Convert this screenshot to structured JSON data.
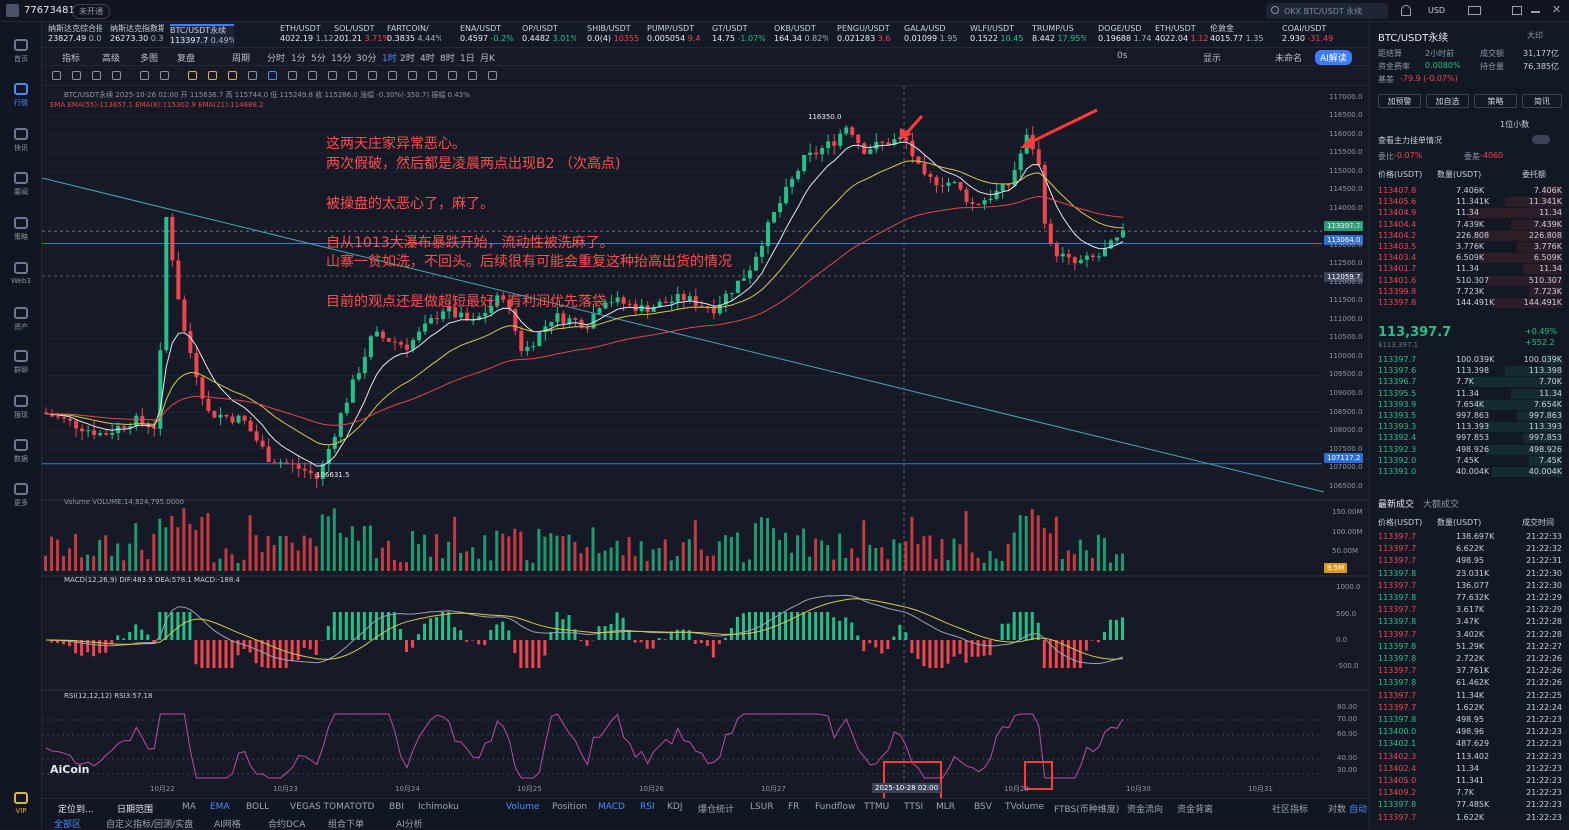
{
  "topbar": {
    "account": "77673481",
    "badge": "未开通",
    "search_placeholder": "OKX BTC/USDT 永续",
    "currency": "USD"
  },
  "leftnav": [
    {
      "label": "首页"
    },
    {
      "label": "行情"
    },
    {
      "label": "快讯"
    },
    {
      "label": "要闻"
    },
    {
      "label": "策略"
    },
    {
      "label": "Web3"
    },
    {
      "label": "资产"
    },
    {
      "label": "群聊"
    },
    {
      "label": "搜现"
    },
    {
      "label": "数据"
    },
    {
      "label": "更多"
    },
    {
      "label": "VIP"
    }
  ],
  "tickers": [
    {
      "name": "纳斯达克综合指",
      "price": "23827.49",
      "chg": "0.00%",
      "dir": "flat"
    },
    {
      "name": "纳斯达克指数期",
      "price": "26273.30",
      "chg": "0.33%",
      "dir": "flat"
    },
    {
      "name": "BTC/USDT永续",
      "price": "113397.7",
      "chg": "0.49%",
      "dir": "active"
    },
    {
      "name": "ETH/USDT",
      "price": "4022.19",
      "chg": "1.12",
      "dir": "flat"
    },
    {
      "name": "SOL/USDT",
      "price": "201.21",
      "chg": "3.71%",
      "dir": "dn"
    },
    {
      "name": "FARTCOIN/",
      "price": "0.3835",
      "chg": "4.44%",
      "dir": "flat"
    },
    {
      "name": "ENA/USDT",
      "price": "0.4597",
      "chg": "-0.2%",
      "dir": "up"
    },
    {
      "name": "OP/USDT",
      "price": "0.4482",
      "chg": "3.01%",
      "dir": "up"
    },
    {
      "name": "SHIB/USDT",
      "price": "0.0(4)",
      "chg": "10355",
      "dir": "dn"
    },
    {
      "name": "PUMP/USDT",
      "price": "0.005054",
      "chg": "9.4",
      "dir": "dn"
    },
    {
      "name": "GT/USDT",
      "price": "14.75",
      "chg": "-1.07%",
      "dir": "up"
    },
    {
      "name": "OKB/USDT",
      "price": "164.34",
      "chg": "0.82%",
      "dir": "flat"
    },
    {
      "name": "PENGU/USDT",
      "price": "0.021283",
      "chg": "3.6",
      "dir": "dn"
    },
    {
      "name": "GALA/USD",
      "price": "0.01099",
      "chg": "1.95",
      "dir": "flat"
    },
    {
      "name": "WLFI/USDT",
      "price": "0.1522",
      "chg": "10.45",
      "dir": "up"
    },
    {
      "name": "TRUMP/US",
      "price": "8.442",
      "chg": "17.95%",
      "dir": "up"
    },
    {
      "name": "DOGE/USD",
      "price": "0.19688",
      "chg": "1.74",
      "dir": "flat"
    },
    {
      "name": "ETH/USDT",
      "price": "4022.04",
      "chg": "1.12",
      "dir": "dn"
    },
    {
      "name": "伦敦金",
      "price": "4015.77",
      "chg": "1.35%",
      "dir": "flat"
    },
    {
      "name": "COAI/USDT",
      "price": "2.930",
      "chg": "-31.49",
      "dir": "dn"
    }
  ],
  "toolbar1": {
    "indicator": "指标",
    "advanced": "高级",
    "multi": "多图",
    "restore": "复盘",
    "period": "周期",
    "intervals": [
      "分时",
      "1分",
      "5分",
      "15分",
      "30分",
      "1时",
      "2时",
      "4时",
      "8时",
      "1日",
      "月K"
    ],
    "active_interval": "1时",
    "display": "显示",
    "unnamed": "未命名",
    "ai": "AI解读",
    "zero_s": "0s"
  },
  "chart": {
    "info_line": "BTC/USDT永续 2025-10-26 02:00 开 115636.7 高 115744.0 低 115249.8 收 115286.0 涨幅 -0.30%(-350.7) 振幅 0.43%",
    "ema_line": "EMA EMA(55):113657.1 EMA(8):115302.9 EMA(21):114888.2",
    "annotations": [
      "这两天庄家异常恶心。",
      "两次假破，然后都是凌晨两点出现B2 （次高点)",
      "被操盘的太恶心了，麻了。",
      "自从1013大瀑布暴跌开始，流动性被洗麻了。",
      "山寨一贫如洗，不回头。后续很有可能会重复这种抬高出货的情况",
      "目前的观点还是做超短最好，有利润优先落袋"
    ],
    "price_axis": [
      "117000.0",
      "116500.0",
      "116000.0",
      "115500.0",
      "115000.0",
      "114500.0",
      "114000.0",
      "113500.0",
      "113000.0",
      "112500.0",
      "112000.0",
      "111500.0",
      "111000.0",
      "110500.0",
      "110000.0",
      "109500.0",
      "109000.0",
      "108500.0",
      "108000.0",
      "107500.0",
      "107000.0",
      "106500.0"
    ],
    "current_price_tag": "113397.7",
    "line_tag1": "113064.0",
    "crosshair_tag": "112059.7",
    "line_tag2": "107117.2",
    "high_label": "116350.0",
    "low_label": "106631.5",
    "volume_line": "Volume VOLUME:14,824,795.0000",
    "volume_axis": [
      "150.00M",
      "100.00M",
      "50.00M"
    ],
    "volume_tag": "9.5M",
    "macd_line": "MACD(12,26,9) DIF:483.9 DEA:578.1 MACD:-188.4",
    "macd_axis": [
      "1000.0",
      "500.0",
      "0.0",
      "-500.0"
    ],
    "rsi_line": "RSI(12,12,12) RSI3:57.18",
    "rsi_axis": [
      "80.00",
      "70.00",
      "60.00",
      "40.00",
      "30.00"
    ],
    "date_labels": [
      "10月22",
      "10月23",
      "10月24",
      "10月25",
      "10月26",
      "10月27",
      "10月28",
      "10月29",
      "10月30",
      "10月31"
    ],
    "crosshair_date": "2025-10-28 02:00",
    "logo": "AiCoin"
  },
  "chart_data": {
    "type": "line",
    "title": "BTC/USDT永续",
    "ylim": [
      106500,
      117000
    ],
    "x": [
      "10月22",
      "10月23",
      "10月24",
      "10月25",
      "10月26",
      "10月27",
      "10月28",
      "10月29",
      "10月30"
    ],
    "series": [
      {
        "name": "BTC/USDT永续",
        "values": [
          108000,
          106700,
          109800,
          110700,
          111600,
          112800,
          115500,
          115900,
          113400
        ]
      }
    ],
    "high": 116350.0,
    "low": 106631.5,
    "current": 113397.7
  },
  "bottombar": {
    "items": [
      "定位到...",
      "日期范围",
      "MA",
      "EMA",
      "BOLL",
      "VEGAS TOMATO",
      "TD",
      "BBI",
      "Ichimoku",
      "Volume",
      "Position",
      "MACD",
      "RSI",
      "KDJ",
      "爆仓统计",
      "LSUR",
      "FR",
      "Fundflow",
      "TTMU",
      "TTSI",
      "MLR",
      "BSV",
      "TVolume",
      "FTBS(币种维度)",
      "资金流向",
      "资金背离"
    ],
    "right": [
      "社区指标",
      "对数",
      "自动"
    ],
    "row2": [
      "全部区",
      "自定义指标/回测/实盘",
      "AI网格",
      "合约DCA",
      "组合下单",
      "AI分析"
    ]
  },
  "rightpanel": {
    "title": "BTC/USDT永续",
    "size_label": "大印",
    "rows": [
      {
        "l": "距结算",
        "lv": "2小时前",
        "r": "成交额",
        "rv": "31,177亿"
      },
      {
        "l": "资金费率",
        "lv": "0.0080%",
        "r": "持仓量",
        "rv": "76,385亿"
      },
      {
        "l": "基差",
        "lv": "-79.9 (-0.07%)",
        "r": "",
        "rv": ""
      }
    ],
    "buttons": [
      "加预警",
      "加自选",
      "策略",
      "简讯"
    ],
    "depth_label": "1位小数",
    "mainforce": "查看主力挂单情况",
    "ratio_l": "委比",
    "ratio_lv": "-0.07%",
    "diff_l": "委差",
    "diff_v": "-4060",
    "ob_headers": [
      "价格(USDT)",
      "数量(USDT)",
      "委托额"
    ],
    "asks": [
      [
        "113407.8",
        "7.406K",
        "7.406K"
      ],
      [
        "113405.6",
        "11.341K",
        "11.341K"
      ],
      [
        "113404.9",
        "11.34",
        "11.34"
      ],
      [
        "113404.4",
        "7.439K",
        "7.439K"
      ],
      [
        "113404.2",
        "226.808",
        "226.808"
      ],
      [
        "113403.5",
        "3.776K",
        "3.776K"
      ],
      [
        "113403.4",
        "6.509K",
        "6.509K"
      ],
      [
        "113401.7",
        "11.34",
        "11.34"
      ],
      [
        "113401.6",
        "510.307",
        "510.307"
      ],
      [
        "113399.8",
        "7.723K",
        "7.723K"
      ],
      [
        "113397.8",
        "144.491K",
        "144.491K"
      ]
    ],
    "mid_price": "113,397.7",
    "mid_sub": "$113,397.1",
    "mid_chg": "+0.49%",
    "mid_chg2": "+552.2",
    "bids": [
      [
        "113397.7",
        "100.039K",
        "100.039K"
      ],
      [
        "113397.6",
        "113.398",
        "113.398"
      ],
      [
        "113396.7",
        "7.7K",
        "7.70K"
      ],
      [
        "113395.5",
        "11.34",
        "11.34"
      ],
      [
        "113393.9",
        "7.654K",
        "7.654K"
      ],
      [
        "113393.5",
        "997.863",
        "997.863"
      ],
      [
        "113393.3",
        "113.393",
        "113.393"
      ],
      [
        "113392.4",
        "997.853",
        "997.853"
      ],
      [
        "113392.3",
        "498.926",
        "498.926"
      ],
      [
        "113392.0",
        "7.45K",
        "7.45K"
      ],
      [
        "113391.0",
        "40.004K",
        "40.004K"
      ]
    ],
    "trades_tabs": [
      "最新成交",
      "大额成交"
    ],
    "trade_headers": [
      "价格(USDT)",
      "数量(USDT)",
      "成交时间"
    ],
    "trades": [
      [
        "113397.7",
        "138.697K",
        "21:22:33",
        "dn"
      ],
      [
        "113397.7",
        "6.622K",
        "21:22:32",
        "dn"
      ],
      [
        "113397.7",
        "498.95",
        "21:22:31",
        "dn"
      ],
      [
        "113397.8",
        "23.031K",
        "21:22:30",
        "up"
      ],
      [
        "113397.7",
        "136.077",
        "21:22:30",
        "dn"
      ],
      [
        "113397.8",
        "77.632K",
        "21:22:29",
        "up"
      ],
      [
        "113397.7",
        "3.617K",
        "21:22:29",
        "dn"
      ],
      [
        "113397.8",
        "3.47K",
        "21:22:28",
        "up"
      ],
      [
        "113397.7",
        "3.402K",
        "21:22:28",
        "dn"
      ],
      [
        "113397.8",
        "51.29K",
        "21:22:27",
        "up"
      ],
      [
        "113397.8",
        "2.722K",
        "21:22:26",
        "up"
      ],
      [
        "113397.7",
        "37.761K",
        "21:22:26",
        "dn"
      ],
      [
        "113397.8",
        "61.462K",
        "21:22:26",
        "up"
      ],
      [
        "113397.7",
        "11.34K",
        "21:22:25",
        "dn"
      ],
      [
        "113397.7",
        "1.622K",
        "21:22:24",
        "dn"
      ],
      [
        "113397.8",
        "498.95",
        "21:22:23",
        "up"
      ],
      [
        "113400.0",
        "498.96",
        "21:22:23",
        "up"
      ],
      [
        "113402.1",
        "487.629",
        "21:22:23",
        "up"
      ],
      [
        "113402.3",
        "113.402",
        "21:22:23",
        "dn"
      ],
      [
        "113402.4",
        "11.34",
        "21:22:23",
        "dn"
      ],
      [
        "113405.0",
        "11.341",
        "21:22:23",
        "dn"
      ],
      [
        "113409.2",
        "7.7K",
        "21:22:23",
        "dn"
      ],
      [
        "113397.8",
        "77.485K",
        "21:22:23",
        "up"
      ],
      [
        "113397.7",
        "1.622K",
        "21:22:23",
        "dn"
      ]
    ],
    "colors": {
      "up": "#24c08a",
      "down": "#f0454e",
      "accent": "#3c7cff"
    }
  }
}
